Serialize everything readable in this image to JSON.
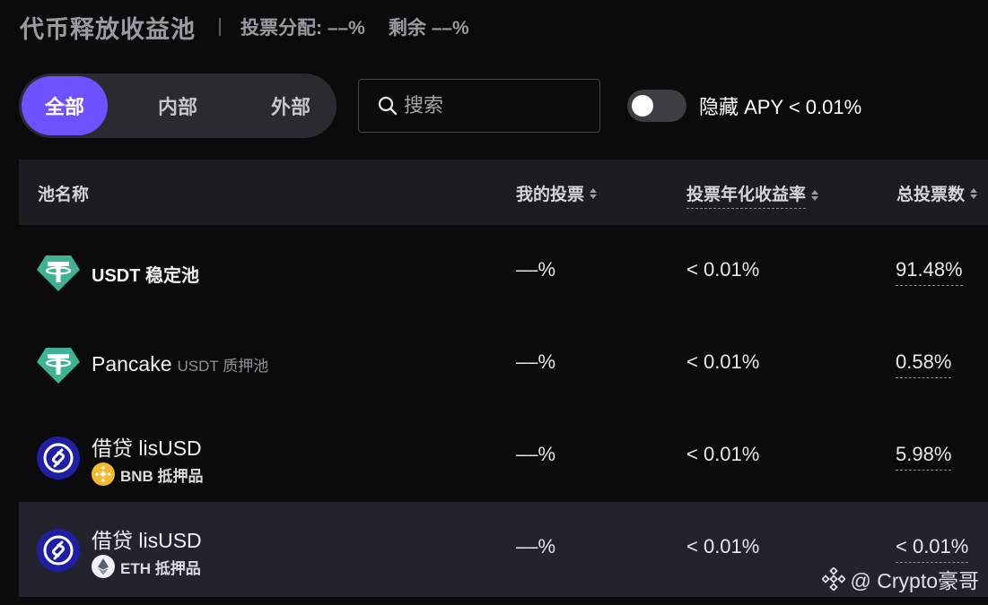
{
  "header": {
    "title": "代币释放收益池",
    "vote_allocation": "投票分配: ––%",
    "remaining": "剩余 ––%"
  },
  "filters": {
    "tabs": [
      "全部",
      "内部",
      "外部"
    ],
    "active": "全部"
  },
  "search": {
    "placeholder": "搜索"
  },
  "toggle": {
    "label": "隐藏 APY < 0.01%",
    "on": false
  },
  "table": {
    "columns": [
      "池名称",
      "我的投票",
      "投票年化收益率",
      "总投票数"
    ],
    "rows": [
      {
        "name": "USDT 稳定池",
        "subtitle": "",
        "collateral": "",
        "icon": "tether-icon",
        "my_vote": "––%",
        "apy": "< 0.01%",
        "total": "91.48%"
      },
      {
        "name": "Pancake",
        "subtitle": "USDT 质押池",
        "collateral": "",
        "icon": "tether-icon",
        "my_vote": "––%",
        "apy": "< 0.01%",
        "total": "0.58%"
      },
      {
        "name": "借贷 lisUSD",
        "subtitle": "",
        "collateral": "BNB 抵押品",
        "icon": "lista-icon",
        "collateral_icon": "bnb-icon",
        "my_vote": "––%",
        "apy": "< 0.01%",
        "total": "5.98%"
      },
      {
        "name": "借贷 lisUSD",
        "subtitle": "",
        "collateral": "ETH 抵押品",
        "icon": "lista-icon",
        "collateral_icon": "eth-icon",
        "my_vote": "––%",
        "apy": "< 0.01%",
        "total": "< 0.01%"
      }
    ]
  },
  "watermark": {
    "text": "@ Crypto豪哥"
  },
  "colors": {
    "accent": "#6f52ff",
    "background": "#0b0b0d",
    "header_bg": "#1c1c22",
    "tether": "#3fb293",
    "lista": "#1f1fa3",
    "bnb": "#f3ba2f"
  }
}
